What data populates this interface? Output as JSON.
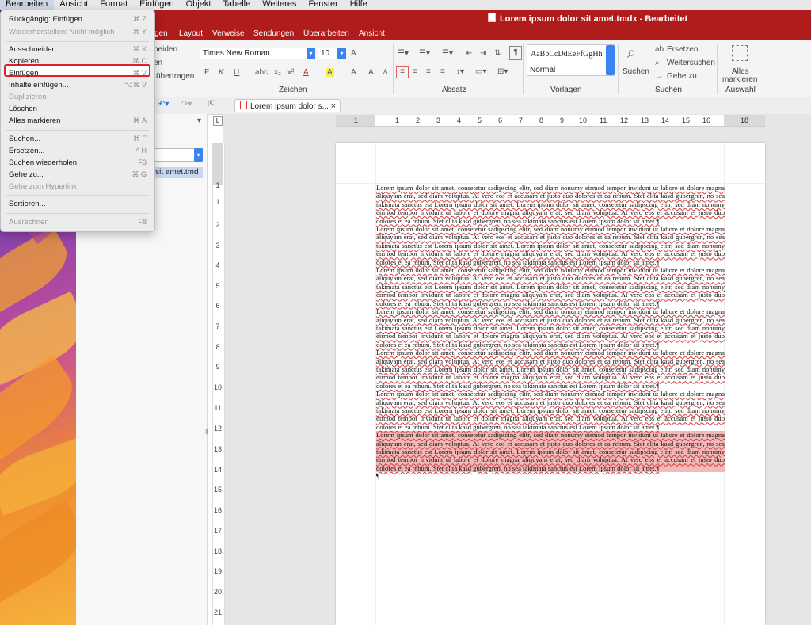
{
  "menubar": {
    "items": [
      "Bearbeiten",
      "Ansicht",
      "Format",
      "Einfügen",
      "Objekt",
      "Tabelle",
      "Weiteres",
      "Fenster",
      "Hilfe"
    ]
  },
  "window": {
    "title": "Lorem ipsum dolor sit amet.tmdx - Bearbeitet"
  },
  "ribbon": {
    "tabs": [
      "gen",
      "Layout",
      "Verweise",
      "Sendungen",
      "Überarbeiten",
      "Ansicht"
    ],
    "clipboard": {
      "cut": "neiden",
      "transfer": "übertragen"
    },
    "font": {
      "name": "Times New Roman",
      "size": "10",
      "grow": "A",
      "bold": "F",
      "italic": "K",
      "underline": "U",
      "color": "A",
      "highlight": "A",
      "clear": "A",
      "enlarge": "A",
      "shrink": "A"
    },
    "groups": {
      "zeichen": "Zeichen",
      "absatz": "Absatz",
      "vorlagen": "Vorlagen",
      "suchen": "Suchen",
      "auswahl": "Auswahl"
    },
    "styles": {
      "preview": "AaBbCcDdEeFfGgHh",
      "current": "Normal"
    },
    "search": {
      "label": "Suchen",
      "replace": "Ersetzen",
      "find_next": "Weitersuchen",
      "goto": "Gehe zu"
    },
    "select_all": {
      "line1": "Alles",
      "line2": "markieren"
    },
    "pilcrow": "¶"
  },
  "document_tab": {
    "label": "Lorem ipsum dolor s...",
    "close": "×"
  },
  "nav_pane": {
    "result": "r sit amet.tmd"
  },
  "vruler": {
    "labels": [
      "1",
      "1",
      "2",
      "3",
      "4",
      "5",
      "6",
      "7",
      "8",
      "9",
      "10",
      "11",
      "12",
      "13",
      "14",
      "15",
      "16",
      "17",
      "18",
      "19",
      "20",
      "21"
    ]
  },
  "hruler": {
    "labels": [
      "1",
      "1",
      "2",
      "3",
      "4",
      "5",
      "6",
      "7",
      "8",
      "9",
      "10",
      "11",
      "12",
      "13",
      "14",
      "15",
      "16",
      "18"
    ]
  },
  "document": {
    "paragraphs": [
      "Lorem ipsum dolor sit amet, consetetur sadipscing elitr, sed diam nonumy eirmod tempor invidunt ut labore et dolore magna aliquyam erat, sed diam voluptua. At vero eos et accusam et justo duo dolores et ea rebum. Stet clita kasd gubergren, no sea takimata sanctus est Lorem ipsum dolor sit amet. Lorem ipsum dolor sit amet, consetetur sadipscing elitr, sed diam nonumy eirmod tempor invidunt ut labore et dolore magna aliquyam erat, sed diam voluptua. At vero eos et accusam et justo duo dolores et ea rebum. Stet clita kasd gubergren, no sea takimata sanctus est Lorem ipsum dolor sit amet.¶",
      "Lorem ipsum dolor sit amet, consetetur sadipscing elitr, sed diam nonumy eirmod tempor invidunt ut labore et dolore magna aliquyam erat, sed diam voluptua. At vero eos et accusam et justo duo dolores et ea rebum. Stet clita kasd gubergren, no sea takimata sanctus est Lorem ipsum dolor sit amet. Lorem ipsum dolor sit amet, consetetur sadipscing elitr, sed diam nonumy eirmod tempor invidunt ut labore et dolore magna aliquyam erat, sed diam voluptua. At vero eos et accusam et justo duo dolores et ea rebum. Stet clita kasd gubergren, no sea takimata sanctus est Lorem ipsum dolor sit amet.¶",
      "Lorem ipsum dolor sit amet, consetetur sadipscing elitr, sed diam nonumy eirmod tempor invidunt ut labore et dolore magna aliquyam erat, sed diam voluptua. At vero eos et accusam et justo duo dolores et ea rebum. Stet clita kasd gubergren, no sea takimata sanctus est Lorem ipsum dolor sit amet. Lorem ipsum dolor sit amet, consetetur sadipscing elitr, sed diam nonumy eirmod tempor invidunt ut labore et dolore magna aliquyam erat, sed diam voluptua. At vero eos et accusam et justo duo dolores et ea rebum. Stet clita kasd gubergren, no sea takimata sanctus est Lorem ipsum dolor sit amet.¶",
      "Lorem ipsum dolor sit amet, consetetur sadipscing elitr, sed diam nonumy eirmod tempor invidunt ut labore et dolore magna aliquyam erat, sed diam voluptua. At vero eos et accusam et justo duo dolores et ea rebum. Stet clita kasd gubergren, no sea takimata sanctus est Lorem ipsum dolor sit amet. Lorem ipsum dolor sit amet, consetetur sadipscing elitr, sed diam nonumy eirmod tempor invidunt ut labore et dolore magna aliquyam erat, sed diam voluptua. At vero eos et accusam et justo duo dolores et ea rebum. Stet clita kasd gubergren, no sea takimata sanctus est Lorem ipsum dolor sit amet.¶",
      "Lorem ipsum dolor sit amet, consetetur sadipscing elitr, sed diam nonumy eirmod tempor invidunt ut labore et dolore magna aliquyam erat, sed diam voluptua. At vero eos et accusam et justo duo dolores et ea rebum. Stet clita kasd gubergren, no sea takimata sanctus est Lorem ipsum dolor sit amet. Lorem ipsum dolor sit amet, consetetur sadipscing elitr, sed diam nonumy eirmod tempor invidunt ut labore et dolore magna aliquyam erat, sed diam voluptua. At vero eos et accusam et justo duo dolores et ea rebum. Stet clita kasd gubergren, no sea takimata sanctus est Lorem ipsum dolor sit amet.¶",
      "Lorem ipsum dolor sit amet, consetetur sadipscing elitr, sed diam nonumy eirmod tempor invidunt ut labore et dolore magna aliquyam erat, sed diam voluptua. At vero eos et accusam et justo duo dolores et ea rebum. Stet clita kasd gubergren, no sea takimata sanctus est Lorem ipsum dolor sit amet. Lorem ipsum dolor sit amet, consetetur sadipscing elitr, sed diam nonumy eirmod tempor invidunt ut labore et dolore magna aliquyam erat, sed diam voluptua. At vero eos et accusam et justo duo dolores et ea rebum. Stet clita kasd gubergren, no sea takimata sanctus est Lorem ipsum dolor sit amet.¶",
      "Lorem ipsum dolor sit amet, consetetur sadipscing elitr, sed diam nonumy eirmod tempor invidunt ut labore et dolore magna aliquyam erat, sed diam voluptua. At vero eos et accusam et justo duo dolores et ea rebum. Stet clita kasd gubergren, no sea takimata sanctus est Lorem ipsum dolor sit amet. Lorem ipsum dolor sit amet, consetetur sadipscing elitr, sed diam nonumy eirmod tempor invidunt ut labore et dolore magna aliquyam erat, sed diam voluptua. At vero eos et accusam et justo duo dolores et ea rebum. Stet clita kasd gubergren, no sea takimata sanctus est Lorem ipsum dolor sit amet.¶"
    ],
    "end_mark": "¶"
  },
  "edit_menu": {
    "items": [
      {
        "label": "Rückgängig: Einfügen",
        "shortcut": "⌘ Z",
        "disabled": false
      },
      {
        "label": "Wiederherstellen: Nicht möglich",
        "shortcut": "⌘ Y",
        "disabled": true
      },
      {
        "label": "Ausschneiden",
        "shortcut": "⌘ X",
        "disabled": false
      },
      {
        "label": "Kopieren",
        "shortcut": "⌘ C",
        "disabled": false
      },
      {
        "label": "Einfügen",
        "shortcut": "⌘ V",
        "disabled": false
      },
      {
        "label": "Inhalte einfügen...",
        "shortcut": "⌥⌘ V",
        "disabled": false
      },
      {
        "label": "Duplizieren",
        "shortcut": "",
        "disabled": true
      },
      {
        "label": "Löschen",
        "shortcut": "",
        "disabled": false
      },
      {
        "label": "Alles markieren",
        "shortcut": "⌘ A",
        "disabled": false
      },
      {
        "label": "Suchen...",
        "shortcut": "⌘ F",
        "disabled": false
      },
      {
        "label": "Ersetzen...",
        "shortcut": "^ H",
        "disabled": false
      },
      {
        "label": "Suchen wiederholen",
        "shortcut": "F3",
        "disabled": false
      },
      {
        "label": "Gehe zu...",
        "shortcut": "⌘ G",
        "disabled": false
      },
      {
        "label": "Gehe zum Hyperlink",
        "shortcut": "",
        "disabled": true
      },
      {
        "label": "Sortieren...",
        "shortcut": "",
        "disabled": false
      },
      {
        "label": "Ausrechnen",
        "shortcut": "F8",
        "disabled": true
      }
    ]
  },
  "colors": {
    "title_bar": "#b01b1b",
    "accent_blue": "#3a84f2",
    "selection_pink": "#f3b8b8",
    "menu_highlight_border": "#e0202a"
  }
}
